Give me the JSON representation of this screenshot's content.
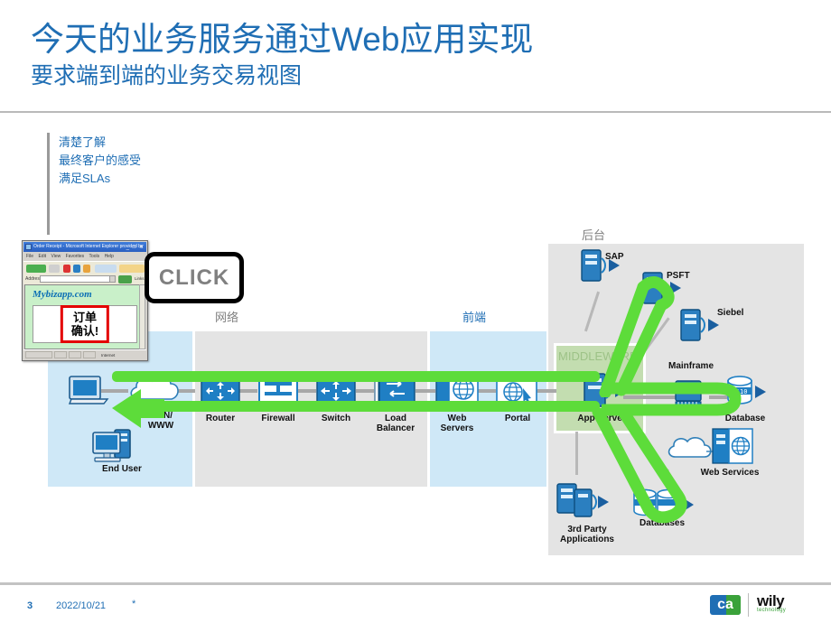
{
  "slide": {
    "title_main": "今天的业务服务通过Web应用实现",
    "title_sub": "要求端到端的业务交易视图",
    "bullets": [
      "清楚了解",
      "最终客户的感受",
      "满足SLAs"
    ]
  },
  "callout": {
    "label": "CLICK"
  },
  "browser": {
    "window_title": "Order Receipt - Microsoft Internet Explorer provided by",
    "menu": [
      "File",
      "Edit",
      "View",
      "Favorites",
      "Tools",
      "Help"
    ],
    "toolbar": [
      "Back",
      "Forward",
      "Stop",
      "Refresh",
      "Home",
      "Search",
      "Favorites"
    ],
    "address_label": "Address",
    "address_value": "",
    "go_label": "Go",
    "links_label": "Links",
    "site_title": "Mybizapp.com",
    "confirm_text": "订单\n确认!",
    "status_text": "Internet"
  },
  "zones": [
    {
      "id": "end-user",
      "label": "",
      "color": "#cfe8f7"
    },
    {
      "id": "network",
      "label": "网络",
      "color": "#e4e4e4"
    },
    {
      "id": "front-end",
      "label": "前端",
      "color": "#cfe8f7"
    },
    {
      "id": "back-office",
      "label": "后台",
      "color": "#e4e4e4"
    }
  ],
  "middleware": {
    "label": "MIDDLEWARE",
    "color": "#c3ddb0"
  },
  "nodes": {
    "end_user": "End User",
    "wan_www": "WAN/\nWWW",
    "router": "Router",
    "firewall": "Firewall",
    "switch": "Switch",
    "load_balancer": "Load\nBalancer",
    "web_servers": "Web\nServers",
    "portal": "Portal",
    "app_server": "App Server",
    "sap": "SAP",
    "psft": "PSFT",
    "siebel": "Siebel",
    "mainframe": "Mainframe",
    "database": "Database",
    "web_services": "Web Services",
    "databases": "Databases",
    "third_party": "3rd  Party\nApplications",
    "third_party_sup": "rd"
  },
  "path": {
    "color": "#5ddc3a",
    "description": "end-to-end business transaction flow"
  },
  "footer": {
    "page_number": "3",
    "date": "2022/10/21",
    "marker": "*",
    "logo_ca_left": "c",
    "logo_ca_right": "a",
    "logo_wily_name": "wily",
    "logo_wily_tag": "technology"
  }
}
